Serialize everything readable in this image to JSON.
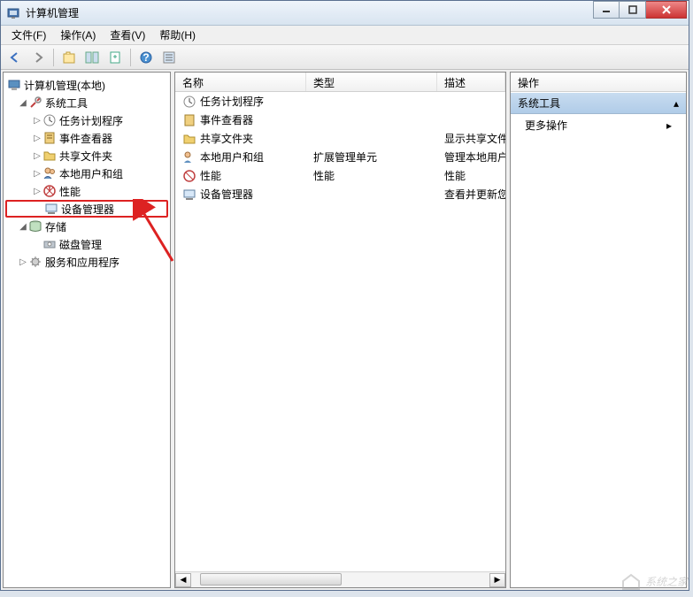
{
  "window": {
    "title": "计算机管理"
  },
  "menu": {
    "file": "文件(F)",
    "action": "操作(A)",
    "view": "查看(V)",
    "help": "帮助(H)"
  },
  "tree": {
    "root": "计算机管理(本地)",
    "system_tools": "系统工具",
    "task_scheduler": "任务计划程序",
    "event_viewer": "事件查看器",
    "shared_folders": "共享文件夹",
    "local_users": "本地用户和组",
    "performance": "性能",
    "device_manager": "设备管理器",
    "storage": "存储",
    "disk_mgmt": "磁盘管理",
    "services_apps": "服务和应用程序"
  },
  "list": {
    "cols": {
      "name": "名称",
      "type": "类型",
      "desc": "描述"
    },
    "rows": [
      {
        "name": "任务计划程序",
        "type": "",
        "desc": ""
      },
      {
        "name": "事件查看器",
        "type": "",
        "desc": ""
      },
      {
        "name": "共享文件夹",
        "type": "",
        "desc": "显示共享文件"
      },
      {
        "name": "本地用户和组",
        "type": "扩展管理单元",
        "desc": "管理本地用户"
      },
      {
        "name": "性能",
        "type": "性能",
        "desc": "性能"
      },
      {
        "name": "设备管理器",
        "type": "",
        "desc": "查看并更新您"
      }
    ]
  },
  "actions": {
    "header": "操作",
    "section": "系统工具",
    "more": "更多操作"
  },
  "watermark": "系统之家",
  "icons": {
    "computer": "computer-icon",
    "tools": "tools-icon",
    "clock": "clock-icon",
    "event": "event-icon",
    "folder": "folder-icon",
    "users": "users-icon",
    "perf": "perf-icon",
    "device": "device-icon",
    "storage": "storage-icon",
    "disk": "disk-icon",
    "services": "services-icon"
  }
}
